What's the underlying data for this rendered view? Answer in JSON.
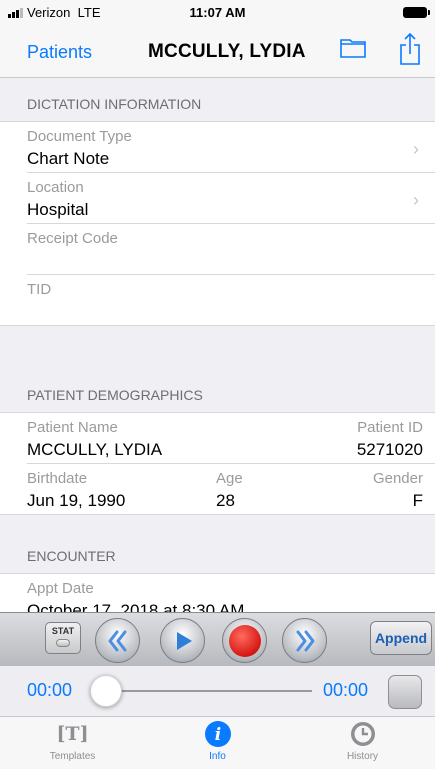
{
  "status_bar": {
    "carrier": "Verizon",
    "network": "LTE",
    "time": "11:07 AM"
  },
  "nav": {
    "back_label": "Patients",
    "title": "MCCULLY, LYDIA",
    "folder_icon": "folder-icon",
    "share_icon": "share-icon"
  },
  "dictation": {
    "header": "DICTATION INFORMATION",
    "document_type": {
      "label": "Document Type",
      "value": "Chart Note"
    },
    "location": {
      "label": "Location",
      "value": "Hospital"
    },
    "receipt_code": {
      "label": "Receipt Code",
      "value": ""
    },
    "tid": {
      "label": "TID",
      "value": ""
    }
  },
  "demographics": {
    "header": "PATIENT DEMOGRAPHICS",
    "patient_name_label": "Patient Name",
    "patient_name": "MCCULLY, LYDIA",
    "patient_id_label": "Patient ID",
    "patient_id": "5271020",
    "birthdate_label": "Birthdate",
    "birthdate": "Jun 19, 1990",
    "age_label": "Age",
    "age": "28",
    "gender_label": "Gender",
    "gender": "F"
  },
  "encounter": {
    "header": "ENCOUNTER",
    "appt_label": "Appt Date",
    "appt_value": "October 17, 2018 at 8:30 AM"
  },
  "player": {
    "stat_label": "STAT",
    "append_label": "Append",
    "elapsed": "00:00",
    "total": "00:00",
    "progress": 0,
    "record_color": "#e8201c",
    "accent_color": "#0a7aff"
  },
  "tabs": [
    {
      "label": "Templates",
      "icon": "templates-icon",
      "glyph": "[T]"
    },
    {
      "label": "Info",
      "icon": "info-icon",
      "glyph": "i"
    },
    {
      "label": "History",
      "icon": "history-icon",
      "glyph": ""
    }
  ],
  "active_tab": "Info"
}
